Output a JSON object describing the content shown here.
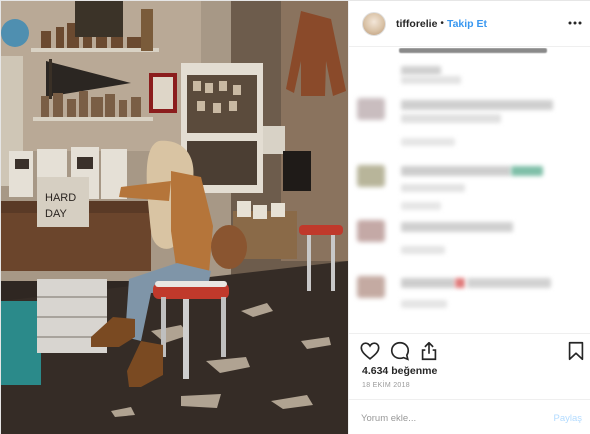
{
  "header": {
    "username": "tifforelie",
    "separator": "•",
    "follow_label": "Takip Et",
    "avatar_icon": "avatar-photo",
    "more_icon": "more-options-icon"
  },
  "caption_fragment": "",
  "actions": {
    "like_icon": "heart-icon",
    "comment_icon": "comment-bubble-icon",
    "share_icon": "share-icon",
    "save_icon": "bookmark-icon"
  },
  "likes": "4.634 beğenme",
  "date": "18 EKİM 2018",
  "comment_box": {
    "placeholder": "Yorum ekle...",
    "post_label": "Paylaş"
  },
  "colors": {
    "accent": "#3897f0",
    "post_disabled": "#b3dbff",
    "text": "#262626",
    "muted": "#999999",
    "border": "#efefef"
  }
}
